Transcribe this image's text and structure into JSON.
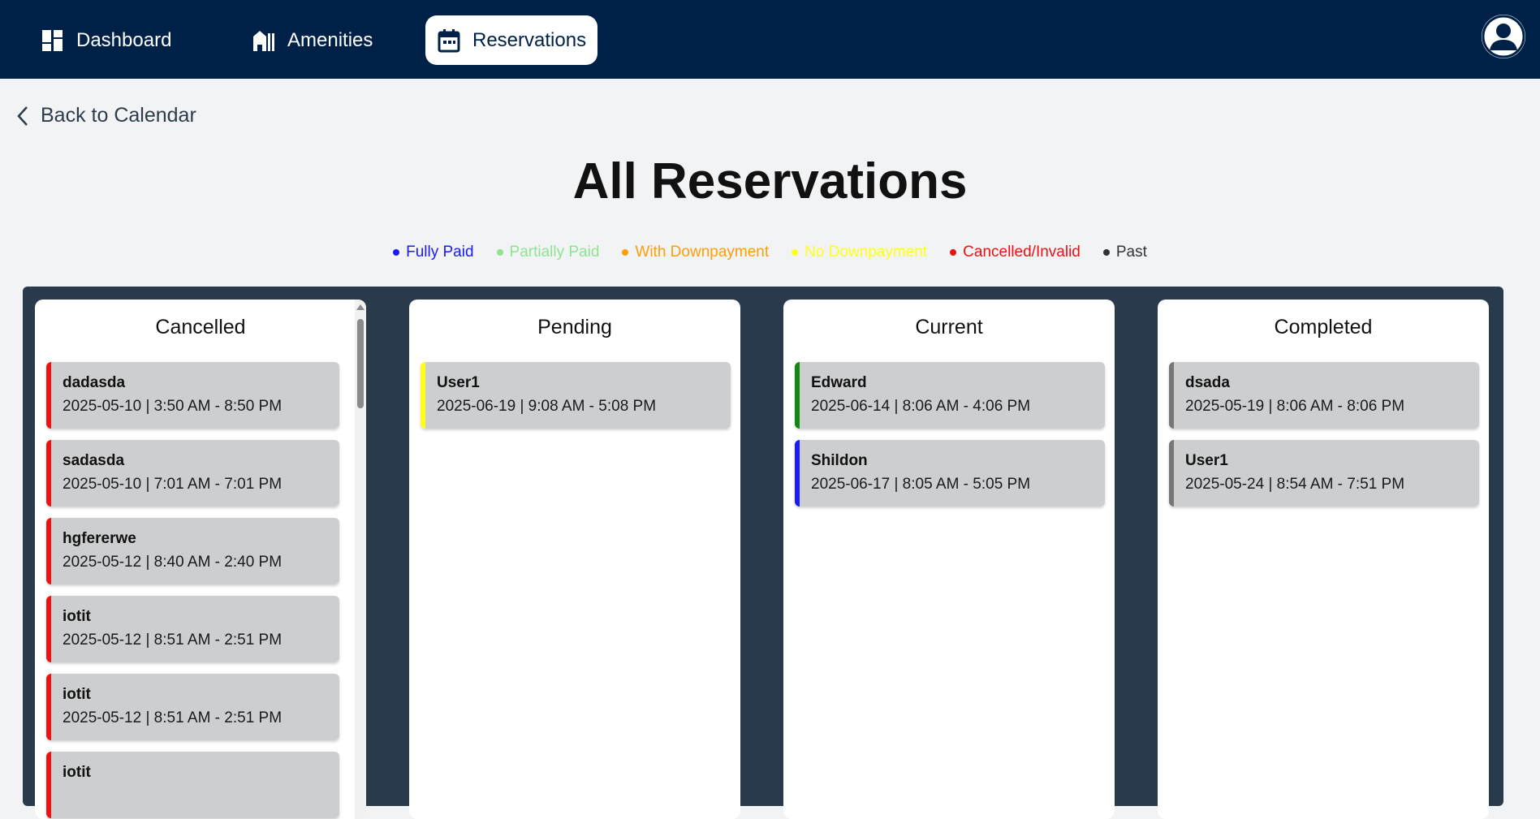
{
  "nav": {
    "items": [
      {
        "label": "Dashboard",
        "icon": "dashboard-icon"
      },
      {
        "label": "Amenities",
        "icon": "building-icon"
      },
      {
        "label": "Reservations",
        "icon": "calendar-icon",
        "active": true
      }
    ],
    "avatar_icon": "user-avatar-icon"
  },
  "back": {
    "label": "Back to Calendar",
    "icon": "chevron-left-icon"
  },
  "page_title": "All Reservations",
  "legend": [
    {
      "label": "Fully Paid",
      "color": "#1a1aff"
    },
    {
      "label": "Partially Paid",
      "color": "#8fe58f"
    },
    {
      "label": "With Downpayment",
      "color": "#ff9d0a"
    },
    {
      "label": "No Downpayment",
      "color": "#ffff1a"
    },
    {
      "label": "Cancelled/Invalid",
      "color": "#ee1111"
    },
    {
      "label": "Past",
      "color": "#333333"
    }
  ],
  "columns": [
    {
      "title": "Cancelled",
      "cards": [
        {
          "name": "dadasda",
          "time": "2025-05-10 | 3:50 AM - 8:50 PM",
          "color": "#ee1111"
        },
        {
          "name": "sadasda",
          "time": "2025-05-10 | 7:01 AM - 7:01 PM",
          "color": "#ee1111"
        },
        {
          "name": "hgfererwe",
          "time": "2025-05-12 | 8:40 AM - 2:40 PM",
          "color": "#ee1111"
        },
        {
          "name": "iotit",
          "time": "2025-05-12 | 8:51 AM - 2:51 PM",
          "color": "#ee1111"
        },
        {
          "name": "iotit",
          "time": "2025-05-12 | 8:51 AM - 2:51 PM",
          "color": "#ee1111"
        },
        {
          "name": "iotit",
          "time": "",
          "color": "#ee1111"
        }
      ]
    },
    {
      "title": "Pending",
      "cards": [
        {
          "name": "User1",
          "time": "2025-06-19 | 9:08 AM - 5:08 PM",
          "color": "#ffff1a"
        }
      ]
    },
    {
      "title": "Current",
      "cards": [
        {
          "name": "Edward",
          "time": "2025-06-14 | 8:06 AM - 4:06 PM",
          "color": "#118811"
        },
        {
          "name": "Shildon",
          "time": "2025-06-17 | 8:05 AM - 5:05 PM",
          "color": "#1a1aff"
        }
      ]
    },
    {
      "title": "Completed",
      "cards": [
        {
          "name": "dsada",
          "time": "2025-05-19 | 8:06 AM - 8:06 PM",
          "color": "#777777"
        },
        {
          "name": "User1",
          "time": "2025-05-24 | 8:54 AM - 7:51 PM",
          "color": "#777777"
        }
      ]
    }
  ]
}
